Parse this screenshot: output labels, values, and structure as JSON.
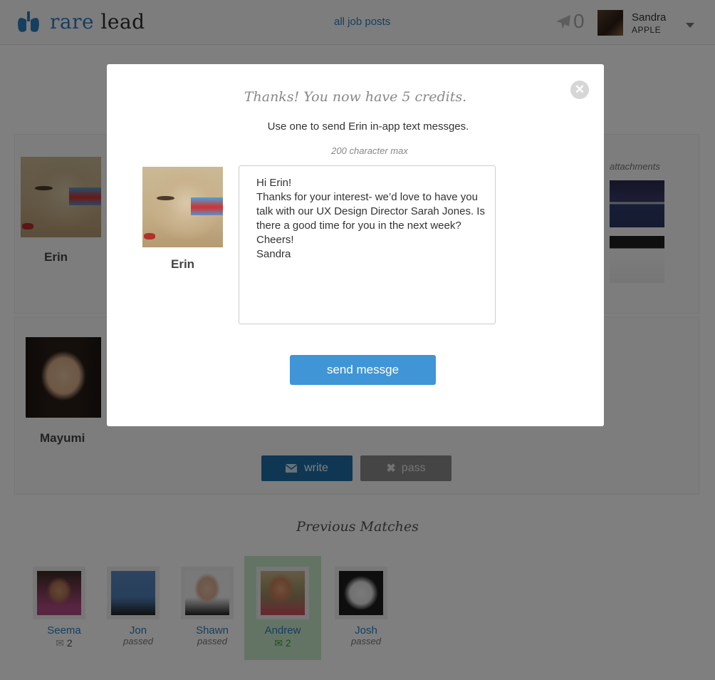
{
  "header": {
    "brand_rare": "rare",
    "brand_lead": "lead",
    "nav_link": "all job posts",
    "credits_count": "0",
    "user_name": "Sandra",
    "user_company": "APPLE"
  },
  "candidates": [
    {
      "name": "Erin"
    },
    {
      "name": "Mayumi"
    }
  ],
  "attachments_label": "attachments",
  "actions": {
    "write": "write",
    "pass": "pass"
  },
  "previous_matches": {
    "title": "Previous Matches",
    "items": [
      {
        "name": "Seema",
        "messages": "2",
        "status": ""
      },
      {
        "name": "Jon",
        "messages": "",
        "status": "passed"
      },
      {
        "name": "Shawn",
        "messages": "",
        "status": "passed"
      },
      {
        "name": "Andrew",
        "messages": "2",
        "status": ""
      },
      {
        "name": "Josh",
        "messages": "",
        "status": "passed"
      }
    ]
  },
  "modal": {
    "title": "Thanks! You now have 5 credits.",
    "subtitle": "Use one to send Erin in-app text messges.",
    "char_max": "200 character max",
    "recipient": "Erin",
    "message": "Hi Erin!\nThanks for your interest- we’d love to have you talk with our UX Design Director Sarah Jones. Is there a good time for you in the next week?\nCheers!\nSandra",
    "send_label": "send messge"
  },
  "colors": {
    "brand_blue": "#2a7fbf",
    "send_blue": "#3f95d6",
    "write_blue": "#1f6fa9",
    "active_match_bg": "#c9e9c9"
  }
}
